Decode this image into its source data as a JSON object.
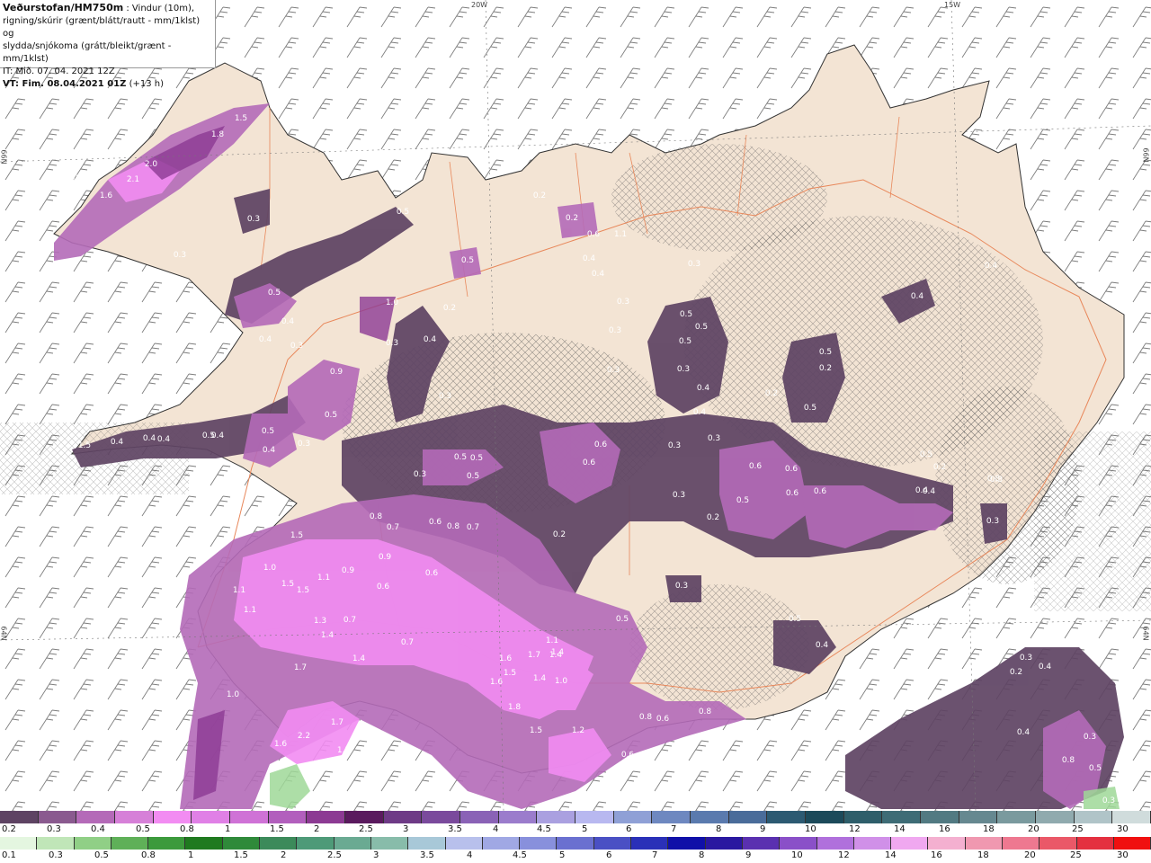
{
  "info": {
    "title": "Veðurstofan/HM750m",
    "line1": ": Vindur (10m),",
    "line2": "rigning/skúrir (grænt/blátt/rautt - mm/1klst) og",
    "line3": "slydda/snjókoma (grátt/bleikt/grænt - mm/1klst)",
    "it": "IT: Mið. 07. 04. 2021 12Z",
    "vt": "VT: Fim. 08.04.2021 01Z",
    "vt_offset": "(+13 h)"
  },
  "grid_labels": {
    "lon_20w": "20W",
    "lon_15w": "15W",
    "lat_66n_left": "66N",
    "lat_66n_right": "66N",
    "lat_64n_left": "64N",
    "lat_64n_right": "64N"
  },
  "colors": {
    "land": "#f3e4d4",
    "sea": "#ffffff",
    "roads": "#e8875a",
    "coast": "#333333"
  },
  "map_values": [
    {
      "v": "1.5"
    },
    {
      "v": "1.8"
    },
    {
      "v": "2.0"
    },
    {
      "v": "2.1"
    },
    {
      "v": "0.2"
    },
    {
      "v": "1.6"
    },
    {
      "v": "0.3"
    },
    {
      "v": "0.3"
    },
    {
      "v": "0.5"
    },
    {
      "v": "0.2"
    },
    {
      "v": "0.5"
    },
    {
      "v": "1.1"
    },
    {
      "v": "0.6"
    },
    {
      "v": "0.4"
    },
    {
      "v": "0.2"
    },
    {
      "v": "0.3"
    },
    {
      "v": "0.4"
    },
    {
      "v": "0.3"
    },
    {
      "v": "0.5"
    },
    {
      "v": "0.4"
    },
    {
      "v": "0.3"
    },
    {
      "v": "0.4"
    },
    {
      "v": "0.2"
    },
    {
      "v": "0.5"
    },
    {
      "v": "0.5"
    },
    {
      "v": "0.5"
    },
    {
      "v": "0.4"
    },
    {
      "v": "0.4"
    },
    {
      "v": "0.5"
    },
    {
      "v": "0.2"
    },
    {
      "v": "1.0"
    },
    {
      "v": "0.3"
    },
    {
      "v": "0.4"
    },
    {
      "v": "0.5"
    },
    {
      "v": "0.3"
    },
    {
      "v": "0.9"
    },
    {
      "v": "0.5"
    },
    {
      "v": "0.3"
    },
    {
      "v": "0.5"
    },
    {
      "v": "0.4"
    },
    {
      "v": "0.3"
    },
    {
      "v": "1.5"
    },
    {
      "v": "0.4"
    },
    {
      "v": "0.4"
    },
    {
      "v": "0.4"
    },
    {
      "v": "0.5"
    },
    {
      "v": "0.4"
    },
    {
      "v": "0.5"
    },
    {
      "v": "0.5"
    },
    {
      "v": "0.3"
    },
    {
      "v": "0.5"
    },
    {
      "v": "0.3"
    },
    {
      "v": "0.6"
    },
    {
      "v": "0.6"
    },
    {
      "v": "0.3"
    },
    {
      "v": "0.3"
    },
    {
      "v": "0.6"
    },
    {
      "v": "0.6"
    },
    {
      "v": "0.6"
    },
    {
      "v": "0.5"
    },
    {
      "v": "0.6"
    },
    {
      "v": "0.5"
    },
    {
      "v": "0.2"
    },
    {
      "v": "0.3"
    },
    {
      "v": "0.4"
    },
    {
      "v": "0.4"
    },
    {
      "v": "0.2"
    },
    {
      "v": "0.8"
    },
    {
      "v": "0.7"
    },
    {
      "v": "0.6"
    },
    {
      "v": "0.8"
    },
    {
      "v": "0.7"
    },
    {
      "v": "1.5"
    },
    {
      "v": "1.0"
    },
    {
      "v": "0.9"
    },
    {
      "v": "0.9"
    },
    {
      "v": "0.6"
    },
    {
      "v": "1.1"
    },
    {
      "v": "1.5"
    },
    {
      "v": "1.5"
    },
    {
      "v": "1.1"
    },
    {
      "v": "1.1"
    },
    {
      "v": "0.6"
    },
    {
      "v": "1.3"
    },
    {
      "v": "0.7"
    },
    {
      "v": "1.4"
    },
    {
      "v": "0.7"
    },
    {
      "v": "1.7"
    },
    {
      "v": "1.4"
    },
    {
      "v": "1.6"
    },
    {
      "v": "1.5"
    },
    {
      "v": "1.7"
    },
    {
      "v": "1.4"
    },
    {
      "v": "1.1"
    },
    {
      "v": "1.4"
    },
    {
      "v": "1.0"
    },
    {
      "v": "1.6"
    },
    {
      "v": "1.4"
    },
    {
      "v": "1.8"
    },
    {
      "v": "1.0"
    },
    {
      "v": "1.7"
    },
    {
      "v": "2.2"
    },
    {
      "v": "1.6"
    },
    {
      "v": "1.3"
    },
    {
      "v": "1.3"
    },
    {
      "v": "1.2"
    },
    {
      "v": "1.5"
    },
    {
      "v": "1.2"
    },
    {
      "v": "0.8"
    },
    {
      "v": "0.6"
    },
    {
      "v": "0.8"
    },
    {
      "v": "0.5"
    },
    {
      "v": "0.6"
    },
    {
      "v": "0.4"
    },
    {
      "v": "0.3"
    },
    {
      "v": "0.3"
    },
    {
      "v": "0.2"
    },
    {
      "v": "0.4"
    },
    {
      "v": "0.4"
    },
    {
      "v": "0.3"
    },
    {
      "v": "0.4"
    },
    {
      "v": "0.3"
    },
    {
      "v": "0.5"
    },
    {
      "v": "0.2"
    },
    {
      "v": "0.4"
    },
    {
      "v": "0.8"
    },
    {
      "v": "0.8"
    },
    {
      "v": "0.3"
    },
    {
      "v": "0.4"
    },
    {
      "v": "0.3"
    },
    {
      "v": "0.5"
    },
    {
      "v": "0.2"
    },
    {
      "v": "0.3"
    }
  ],
  "legend_top": {
    "colors": [
      "#5e4363",
      "#8a5a8f",
      "#b46ab8",
      "#d680d8",
      "#f28cf2",
      "#e080e6",
      "#cf72d6",
      "#b25fbd",
      "#8c3a93",
      "#5a1a5e",
      "#6e3a86",
      "#7a4a9c",
      "#8a62b6",
      "#9b7ccc",
      "#aaa0e0",
      "#b8b8f0",
      "#8fa0d6",
      "#6e88c0",
      "#5a7aae",
      "#4a6c9a",
      "#2c5a72",
      "#1c4a5a",
      "#2e5e6a",
      "#3e6c76",
      "#527a82",
      "#668890",
      "#7a9a9e",
      "#90aaae",
      "#b0c4c8",
      "#d0dcdc"
    ],
    "labels": [
      "0.2",
      "0.3",
      "0.4",
      "0.5",
      "0.8",
      "1",
      "1.5",
      "2",
      "2.5",
      "3",
      "3.5",
      "4",
      "4.5",
      "5",
      "6",
      "7",
      "8",
      "9",
      "10",
      "12",
      "14",
      "16",
      "18",
      "20",
      "25",
      "30"
    ]
  },
  "legend_bottom": {
    "colors": [
      "#e4f6e0",
      "#c0e6b8",
      "#90cf86",
      "#5fb058",
      "#3c9a3c",
      "#1f7a1f",
      "#2f8a3a",
      "#3c8a5a",
      "#4e9a78",
      "#6aaa92",
      "#88bcaa",
      "#a8c8d8",
      "#b8c0ec",
      "#a0a8e4",
      "#8890dc",
      "#6a70d0",
      "#4a50c4",
      "#2a30b8",
      "#1010a8",
      "#2a18a0",
      "#5a30b0",
      "#8a50c8",
      "#b070dc",
      "#d090e8",
      "#f0a8f0",
      "#f4b0d0",
      "#f098b0",
      "#ee7890",
      "#ea5868",
      "#e43040",
      "#f01010"
    ],
    "labels": [
      "0.1",
      "0.3",
      "0.5",
      "0.8",
      "1",
      "1.5",
      "2",
      "2.5",
      "3",
      "3.5",
      "4",
      "4.5",
      "5",
      "6",
      "7",
      "8",
      "9",
      "10",
      "12",
      "14",
      "16",
      "18",
      "20",
      "25",
      "30"
    ]
  }
}
